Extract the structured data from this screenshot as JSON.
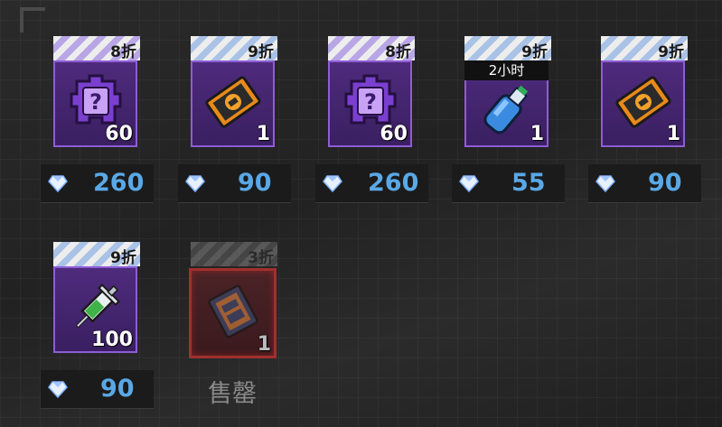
{
  "items": [
    {
      "discount": "8折",
      "quantity": "60",
      "price": "260",
      "icon": "mystery-gear-icon"
    },
    {
      "discount": "9折",
      "quantity": "1",
      "price": "90",
      "icon": "supply-ticket-icon"
    },
    {
      "discount": "8折",
      "quantity": "60",
      "price": "260",
      "icon": "mystery-gear-icon"
    },
    {
      "discount": "9折",
      "timer": "2小时",
      "quantity": "1",
      "price": "55",
      "icon": "potion-bottle-icon"
    },
    {
      "discount": "9折",
      "quantity": "1",
      "price": "90",
      "icon": "supply-ticket-icon"
    },
    {
      "discount": "9折",
      "quantity": "100",
      "price": "90",
      "icon": "syringe-icon"
    },
    {
      "discount": "3折",
      "quantity": "1",
      "status": "售罄",
      "icon": "book-icon"
    }
  ],
  "colors": {
    "tile_purple": "#4e2b7c",
    "tile_border": "#8f5cd6",
    "price_blue": "#5aa8e6",
    "sold_red": "#c0392b"
  }
}
